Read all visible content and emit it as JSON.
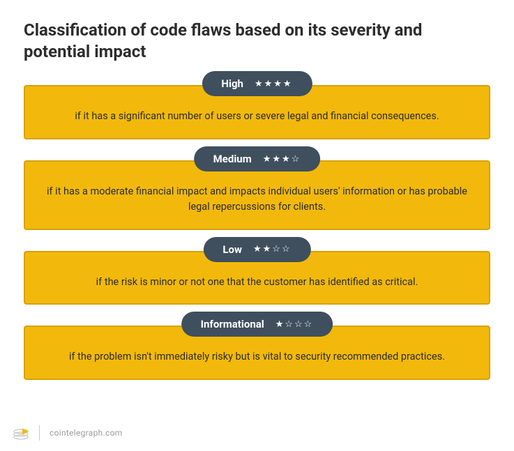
{
  "title": "Classification of code flaws based on its severity and potential impact",
  "levels": [
    {
      "label": "High",
      "stars_filled": 4,
      "stars_total": 4,
      "description": "if it has a significant number of users or severe legal and financial consequences."
    },
    {
      "label": "Medium",
      "stars_filled": 3,
      "stars_total": 4,
      "description": "if it has a moderate financial impact and impacts individual users' information or has probable legal repercussions for clients."
    },
    {
      "label": "Low",
      "stars_filled": 2,
      "stars_total": 4,
      "description": "if the risk is minor or not one that the customer has identified as critical."
    },
    {
      "label": "Informational",
      "stars_filled": 1,
      "stars_total": 4,
      "description": "if the problem isn't immediately risky but is vital to security recommended practices."
    }
  ],
  "footer": {
    "source": "cointelegraph.com"
  },
  "colors": {
    "pill_bg": "#3f4f5e",
    "card_bg": "#f2b90c",
    "card_border": "#d6a108"
  }
}
